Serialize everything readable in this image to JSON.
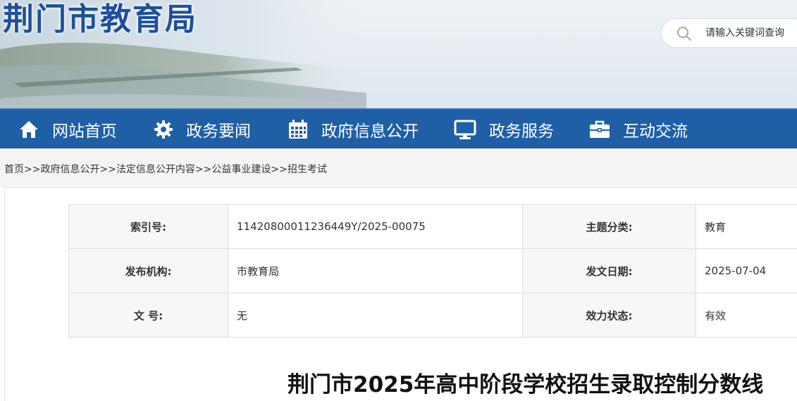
{
  "header": {
    "site_title": "荆门市教育局",
    "search": {
      "placeholder": "请输入关键词查询"
    }
  },
  "nav": {
    "items": [
      {
        "label": "网站首页",
        "icon": "home-icon"
      },
      {
        "label": "政务要闻",
        "icon": "gear-icon"
      },
      {
        "label": "政府信息公开",
        "icon": "calendar-icon"
      },
      {
        "label": "政务服务",
        "icon": "monitor-icon"
      },
      {
        "label": "互动交流",
        "icon": "briefcase-icon"
      }
    ]
  },
  "breadcrumb": {
    "items": [
      "首页",
      "政府信息公开",
      "法定信息公开内容",
      "公益事业建设",
      "招生考试"
    ],
    "separator": ">>"
  },
  "info": {
    "index_label": "索引号:",
    "index_value": "11420800011236449Y/2025-00075",
    "topic_label": "主题分类:",
    "topic_value": "教育",
    "publisher_label": "发布机构:",
    "publisher_value": "市教育局",
    "date_label": "发文日期:",
    "date_value": "2025-07-04",
    "doc_no_label": "文 号:",
    "doc_no_value": "无",
    "status_label": "效力状态:",
    "status_value": "有效"
  },
  "article": {
    "title": "荆门市2025年高中阶段学校招生录取控制分数线"
  },
  "colors": {
    "nav_bg": "#1f5fa6",
    "title_blue": "#1d4f9c"
  }
}
